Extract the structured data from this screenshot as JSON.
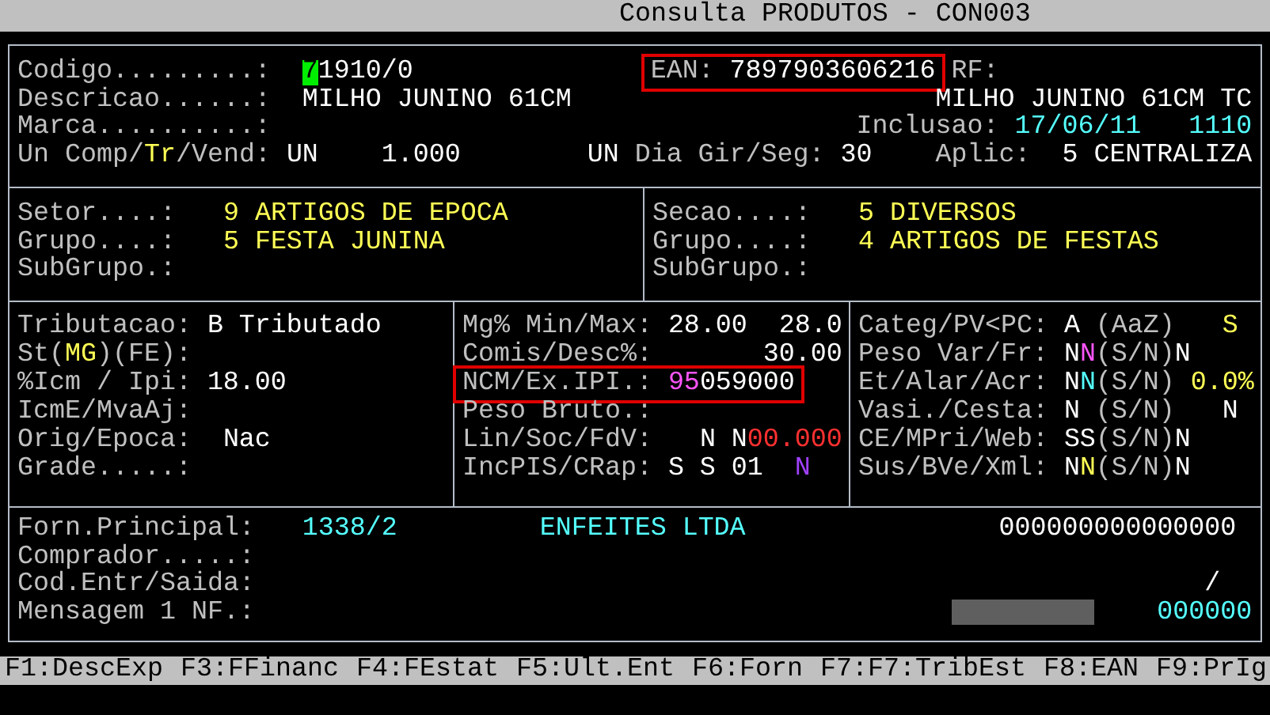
{
  "title": "Consulta PRODUTOS - CON003",
  "panels": [
    {
      "sections": [
        {
          "rows": [
            {
              "items": [
                {
                  "kind": "label",
                  "text": "Codigo.........:"
                },
                {
                  "kind": "value",
                  "text": "71910/0",
                  "cursor": true
                },
                {
                  "kind": "frame",
                  "highlighted": true,
                  "parts": [
                    {
                      "kind": "label",
                      "text": "EAN:"
                    },
                    {
                      "kind": "value",
                      "text": "7897903606216"
                    }
                  ]
                },
                {
                  "kind": "label",
                  "text": "RF:"
                }
              ]
            },
            {
              "items": [
                {
                  "kind": "label",
                  "text": "Descricao......:"
                },
                {
                  "kind": "value",
                  "text": "MILHO JUNINO 61CM"
                },
                {
                  "kind": "value",
                  "text": "MILHO JUNINO 61CM TC"
                }
              ]
            },
            {
              "items": [
                {
                  "kind": "label",
                  "text": "Marca..........:"
                },
                {
                  "kind": "label",
                  "text": "Inclusao:"
                },
                {
                  "kind": "value",
                  "text": "17/06/11",
                  "color": "#55ffff"
                },
                {
                  "kind": "value",
                  "text": "1110",
                  "color": "#55ffff"
                }
              ]
            },
            {
              "items": [
                {
                  "kind": "label",
                  "text": "Un Comp/"
                },
                {
                  "kind": "label",
                  "text": "Tr",
                  "color": "#ffff55"
                },
                {
                  "kind": "label",
                  "text": "/Vend:"
                },
                {
                  "kind": "value",
                  "text": "UN"
                },
                {
                  "kind": "value",
                  "text": "1.000"
                },
                {
                  "kind": "value",
                  "text": "UN"
                },
                {
                  "kind": "label",
                  "text": "Dia Gir/Seg:"
                },
                {
                  "kind": "value",
                  "text": "30"
                },
                {
                  "kind": "label",
                  "text": "Aplic:"
                },
                {
                  "kind": "value",
                  "text": "5 CENTRALIZA"
                }
              ]
            }
          ]
        }
      ]
    },
    {
      "sections": [
        {
          "rows": [
            {
              "items": [
                {
                  "kind": "label",
                  "text": "Setor....:"
                },
                {
                  "kind": "value",
                  "text": "9 ARTIGOS DE EPOCA",
                  "color": "#ffff55"
                }
              ]
            },
            {
              "items": [
                {
                  "kind": "label",
                  "text": "Grupo....:"
                },
                {
                  "kind": "value",
                  "text": "5 FESTA JUNINA",
                  "color": "#ffff55"
                }
              ]
            },
            {
              "items": [
                {
                  "kind": "label",
                  "text": "SubGrupo.:"
                }
              ]
            }
          ]
        },
        {
          "rows": [
            {
              "items": [
                {
                  "kind": "label",
                  "text": "Secao....:"
                },
                {
                  "kind": "value",
                  "text": "5 DIVERSOS",
                  "color": "#ffff55"
                }
              ]
            },
            {
              "items": [
                {
                  "kind": "label",
                  "text": "Grupo....:"
                },
                {
                  "kind": "value",
                  "text": "4 ARTIGOS DE FESTAS",
                  "color": "#ffff55"
                }
              ]
            },
            {
              "items": [
                {
                  "kind": "label",
                  "text": "SubGrupo.:"
                }
              ]
            }
          ]
        }
      ]
    },
    {
      "sections": [
        {
          "rows": [
            {
              "items": [
                {
                  "kind": "label",
                  "text": "Tributacao:"
                },
                {
                  "kind": "value",
                  "text": "B Tributado"
                }
              ]
            },
            {
              "items": [
                {
                  "kind": "label",
                  "text": "St("
                },
                {
                  "kind": "label",
                  "text": "MG",
                  "color": "#ffff55"
                },
                {
                  "kind": "label",
                  "text": ")(FE):"
                }
              ]
            },
            {
              "items": [
                {
                  "kind": "label",
                  "text": "%Icm / Ipi:"
                },
                {
                  "kind": "value",
                  "text": "18.00"
                }
              ]
            },
            {
              "items": [
                {
                  "kind": "label",
                  "text": "IcmE/MvaAj:"
                }
              ]
            },
            {
              "items": [
                {
                  "kind": "label",
                  "text": "Orig/Epoca:"
                },
                {
                  "kind": "value",
                  "text": "Nac"
                }
              ]
            },
            {
              "items": [
                {
                  "kind": "label",
                  "text": "Grade.....:"
                }
              ]
            }
          ]
        },
        {
          "rows": [
            {
              "items": [
                {
                  "kind": "label",
                  "text": "Mg% Min/Max:"
                },
                {
                  "kind": "value",
                  "text": "28.00"
                },
                {
                  "kind": "value",
                  "text": "28.0"
                }
              ]
            },
            {
              "items": [
                {
                  "kind": "label",
                  "text": "Comis/Desc%:"
                },
                {
                  "kind": "value",
                  "text": "30.00"
                }
              ]
            },
            {
              "items": [
                {
                  "kind": "frame",
                  "highlighted": true,
                  "parts": [
                    {
                      "kind": "label",
                      "text": "NCM/Ex.IPI.:"
                    },
                    {
                      "kind": "value",
                      "text": "95",
                      "color": "#ff55ff"
                    },
                    {
                      "kind": "value",
                      "text": "059000"
                    }
                  ]
                }
              ]
            },
            {
              "items": [
                {
                  "kind": "label",
                  "text": "Peso Bruto.:"
                }
              ]
            },
            {
              "items": [
                {
                  "kind": "label",
                  "text": "Lin/Soc/FdV:"
                },
                {
                  "kind": "value",
                  "text": "N"
                },
                {
                  "kind": "value",
                  "text": "N"
                },
                {
                  "kind": "value",
                  "text": "00.000",
                  "color": "#ff3030"
                }
              ]
            },
            {
              "items": [
                {
                  "kind": "label",
                  "text": "IncPIS/CRap:"
                },
                {
                  "kind": "value",
                  "text": "S"
                },
                {
                  "kind": "value",
                  "text": "S"
                },
                {
                  "kind": "value",
                  "text": "01"
                },
                {
                  "kind": "value",
                  "text": "N",
                  "color": "#a040ff"
                }
              ]
            }
          ]
        },
        {
          "rows": [
            {
              "items": [
                {
                  "kind": "label",
                  "text": "Categ/PV<PC:"
                },
                {
                  "kind": "value",
                  "text": "A"
                },
                {
                  "kind": "label",
                  "text": "(AaZ)"
                },
                {
                  "kind": "value",
                  "text": "S",
                  "color": "#ffff55"
                }
              ]
            },
            {
              "items": [
                {
                  "kind": "label",
                  "text": "Peso Var/Fr:"
                },
                {
                  "kind": "value",
                  "text": "N"
                },
                {
                  "kind": "value",
                  "text": "N",
                  "color": "#ff55ff"
                },
                {
                  "kind": "label",
                  "text": "(S/N)"
                },
                {
                  "kind": "value",
                  "text": "N"
                }
              ]
            },
            {
              "items": [
                {
                  "kind": "label",
                  "text": "Et/Alar/Acr:"
                },
                {
                  "kind": "value",
                  "text": "N"
                },
                {
                  "kind": "value",
                  "text": "N",
                  "color": "#55ffff"
                },
                {
                  "kind": "label",
                  "text": "(S/N)"
                },
                {
                  "kind": "value",
                  "text": "0.0%",
                  "color": "#ffff55"
                }
              ]
            },
            {
              "items": [
                {
                  "kind": "label",
                  "text": "Vasi./Cesta:"
                },
                {
                  "kind": "value",
                  "text": "N"
                },
                {
                  "kind": "label",
                  "text": "(S/N)"
                },
                {
                  "kind": "value",
                  "text": "N"
                }
              ]
            },
            {
              "items": [
                {
                  "kind": "label",
                  "text": "CE/MPri/Web:"
                },
                {
                  "kind": "value",
                  "text": "SS"
                },
                {
                  "kind": "label",
                  "text": "(S/N)"
                },
                {
                  "kind": "value",
                  "text": "N"
                }
              ]
            },
            {
              "items": [
                {
                  "kind": "label",
                  "text": "Sus/BVe/Xml:"
                },
                {
                  "kind": "value",
                  "text": "N"
                },
                {
                  "kind": "value",
                  "text": "N",
                  "color": "#ffff55"
                },
                {
                  "kind": "label",
                  "text": "(S/N)"
                },
                {
                  "kind": "value",
                  "text": "N"
                }
              ]
            }
          ]
        }
      ]
    },
    {
      "sections": [
        {
          "rows": [
            {
              "items": [
                {
                  "kind": "label",
                  "text": "Forn.Principal:"
                },
                {
                  "kind": "value",
                  "text": "1338/2",
                  "color": "#55ffff"
                },
                {
                  "kind": "value",
                  "text": "ENFEITES LTDA",
                  "color": "#55ffff"
                },
                {
                  "kind": "value",
                  "text": "000000000000000"
                }
              ]
            },
            {
              "items": [
                {
                  "kind": "label",
                  "text": "Comprador.....:"
                }
              ]
            },
            {
              "items": [
                {
                  "kind": "label",
                  "text": "Cod.Entr/Saida:"
                },
                {
                  "kind": "value",
                  "text": "/"
                }
              ]
            },
            {
              "items": [
                {
                  "kind": "label",
                  "text": "Mensagem 1 NF.:"
                },
                {
                  "kind": "masked"
                },
                {
                  "kind": "value",
                  "text": "000000",
                  "color": "#55ffff"
                }
              ]
            }
          ]
        }
      ]
    }
  ],
  "function_keys": [
    "F1:DescExp",
    "F3:FFinanc",
    "F4:FEstat",
    "F5:Ult.Ent",
    "F6:Forn",
    "F7:F7:TribEst",
    "F8:EAN",
    "F9:PrIg"
  ]
}
